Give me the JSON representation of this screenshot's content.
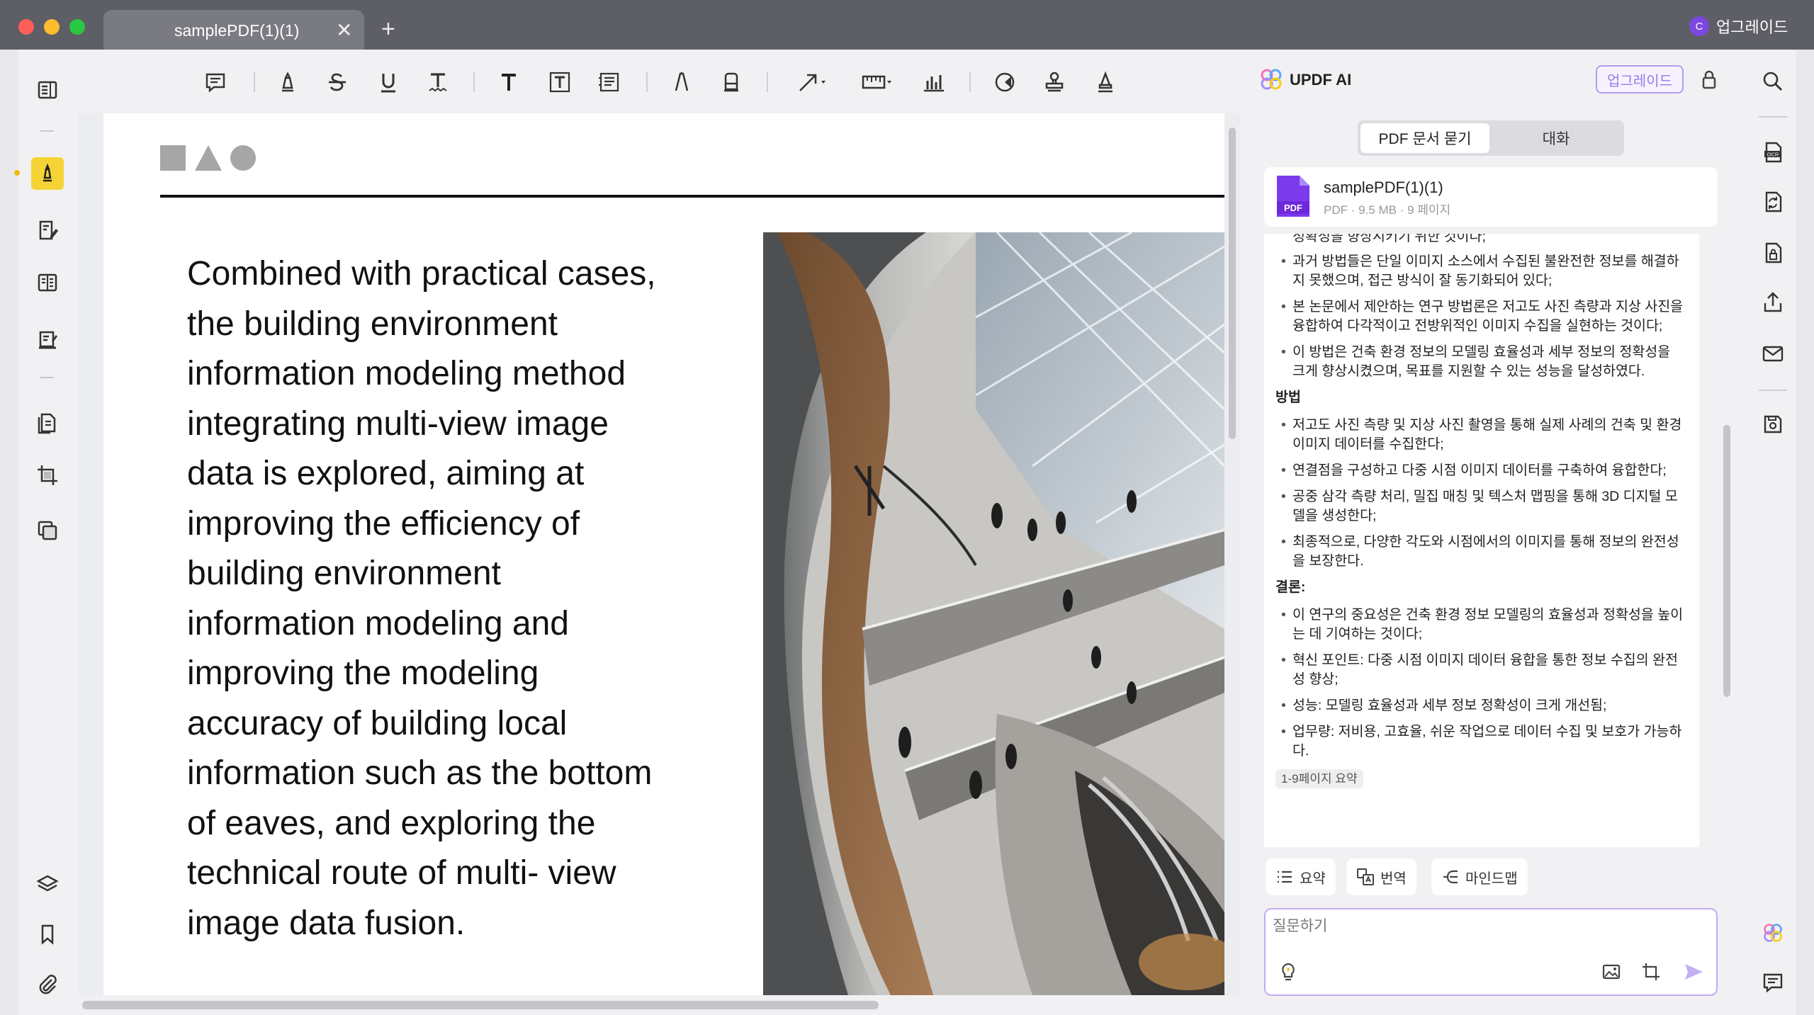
{
  "window": {
    "tab_title": "samplePDF(1)(1)",
    "tab_close": "✕",
    "new_tab": "+",
    "upgrade_label": "업그레이드",
    "avatar_letter": "C",
    "traffic_colors": [
      "#fe5f57",
      "#febc2e",
      "#28c840"
    ]
  },
  "toolbar": {
    "tools": [
      "note",
      "highlight",
      "strikethrough",
      "underline",
      "squiggly",
      "text",
      "text-box",
      "text-callout",
      "pencil",
      "eraser",
      "arrow",
      "measure",
      "chart",
      "shape",
      "stamp",
      "signature"
    ]
  },
  "left_rail": {
    "items": [
      "reader",
      "comment",
      "edit",
      "form",
      "organize",
      "convert",
      "crop",
      "batch",
      "layers",
      "bookmark",
      "attachment"
    ],
    "active": "comment"
  },
  "document": {
    "body_lines": [
      "Combined with practical cases,",
      "the building environment",
      "information modeling method",
      "integrating multi-view image",
      "data is explored, aiming at",
      "improving the efficiency of",
      "building environment",
      "information modeling and",
      "improving the modeling",
      "accuracy of building local",
      "information such as the bottom",
      "of eaves, and exploring the",
      "technical route of multi- view",
      "image data fusion."
    ]
  },
  "ai_panel": {
    "title": "UPDF AI",
    "upgrade_button": "업그레이드",
    "tab_pdf": "PDF 문서 묻기",
    "tab_chat": "대화",
    "file": {
      "name": "samplePDF(1)(1)",
      "icon_label": "PDF",
      "meta": "PDF · 9.5 MB · 9 페이지"
    },
    "chat": {
      "top_fragment": "정확성을 향상시키기 위한 것이다;",
      "intro_items": [
        "과거 방법들은 단일 이미지 소스에서 수집된 불완전한 정보를 해결하지 못했으며, 접근 방식이 잘 동기화되어 있다;",
        "본 논문에서 제안하는 연구 방법론은 저고도 사진 측량과 지상 사진을 융합하여 다각적이고 전방위적인 이미지 수집을 실현하는 것이다;",
        "이 방법은 건축 환경 정보의 모델링 효율성과 세부 정보의 정확성을 크게 향상시켰으며, 목표를 지원할 수 있는 성능을 달성하였다."
      ],
      "method_heading": "방법",
      "method_items": [
        "저고도 사진 측량 및 지상 사진 촬영을 통해 실제 사례의 건축 및 환경 이미지 데이터를 수집한다;",
        "연결점을 구성하고 다중 시점 이미지 데이터를 구축하여 융합한다;",
        "공중 삼각 측량 처리, 밀집 매칭 및 텍스처 맵핑을 통해 3D 디지털 모델을 생성한다;",
        "최종적으로, 다양한 각도와 시점에서의 이미지를 통해 정보의 완전성을 보장한다."
      ],
      "conclusion_heading": "결론:",
      "conclusion_items": [
        "이 연구의 중요성은 건축 환경 정보 모델링의 효율성과 정확성을 높이는 데 기여하는 것이다;",
        "혁신 포인트: 다중 시점 이미지 데이터 융합을 통한 정보 수집의 완전성 향상;",
        "성능: 모델링 효율성과 세부 정보 정확성이 크게 개선됨;",
        "업무량: 저비용, 고효율, 쉬운 작업으로 데이터 수집 및 보호가 가능하다."
      ],
      "page_ref": "1-9페이지 요약"
    },
    "quick_actions": {
      "summary": "요약",
      "translate": "번역",
      "mindmap": "마인드맵"
    },
    "input_placeholder": "질문하기"
  },
  "colors": {
    "accent_purple": "#8b5cf6",
    "highlight_yellow": "#f5d335",
    "titlebar": "#5e5e66"
  }
}
